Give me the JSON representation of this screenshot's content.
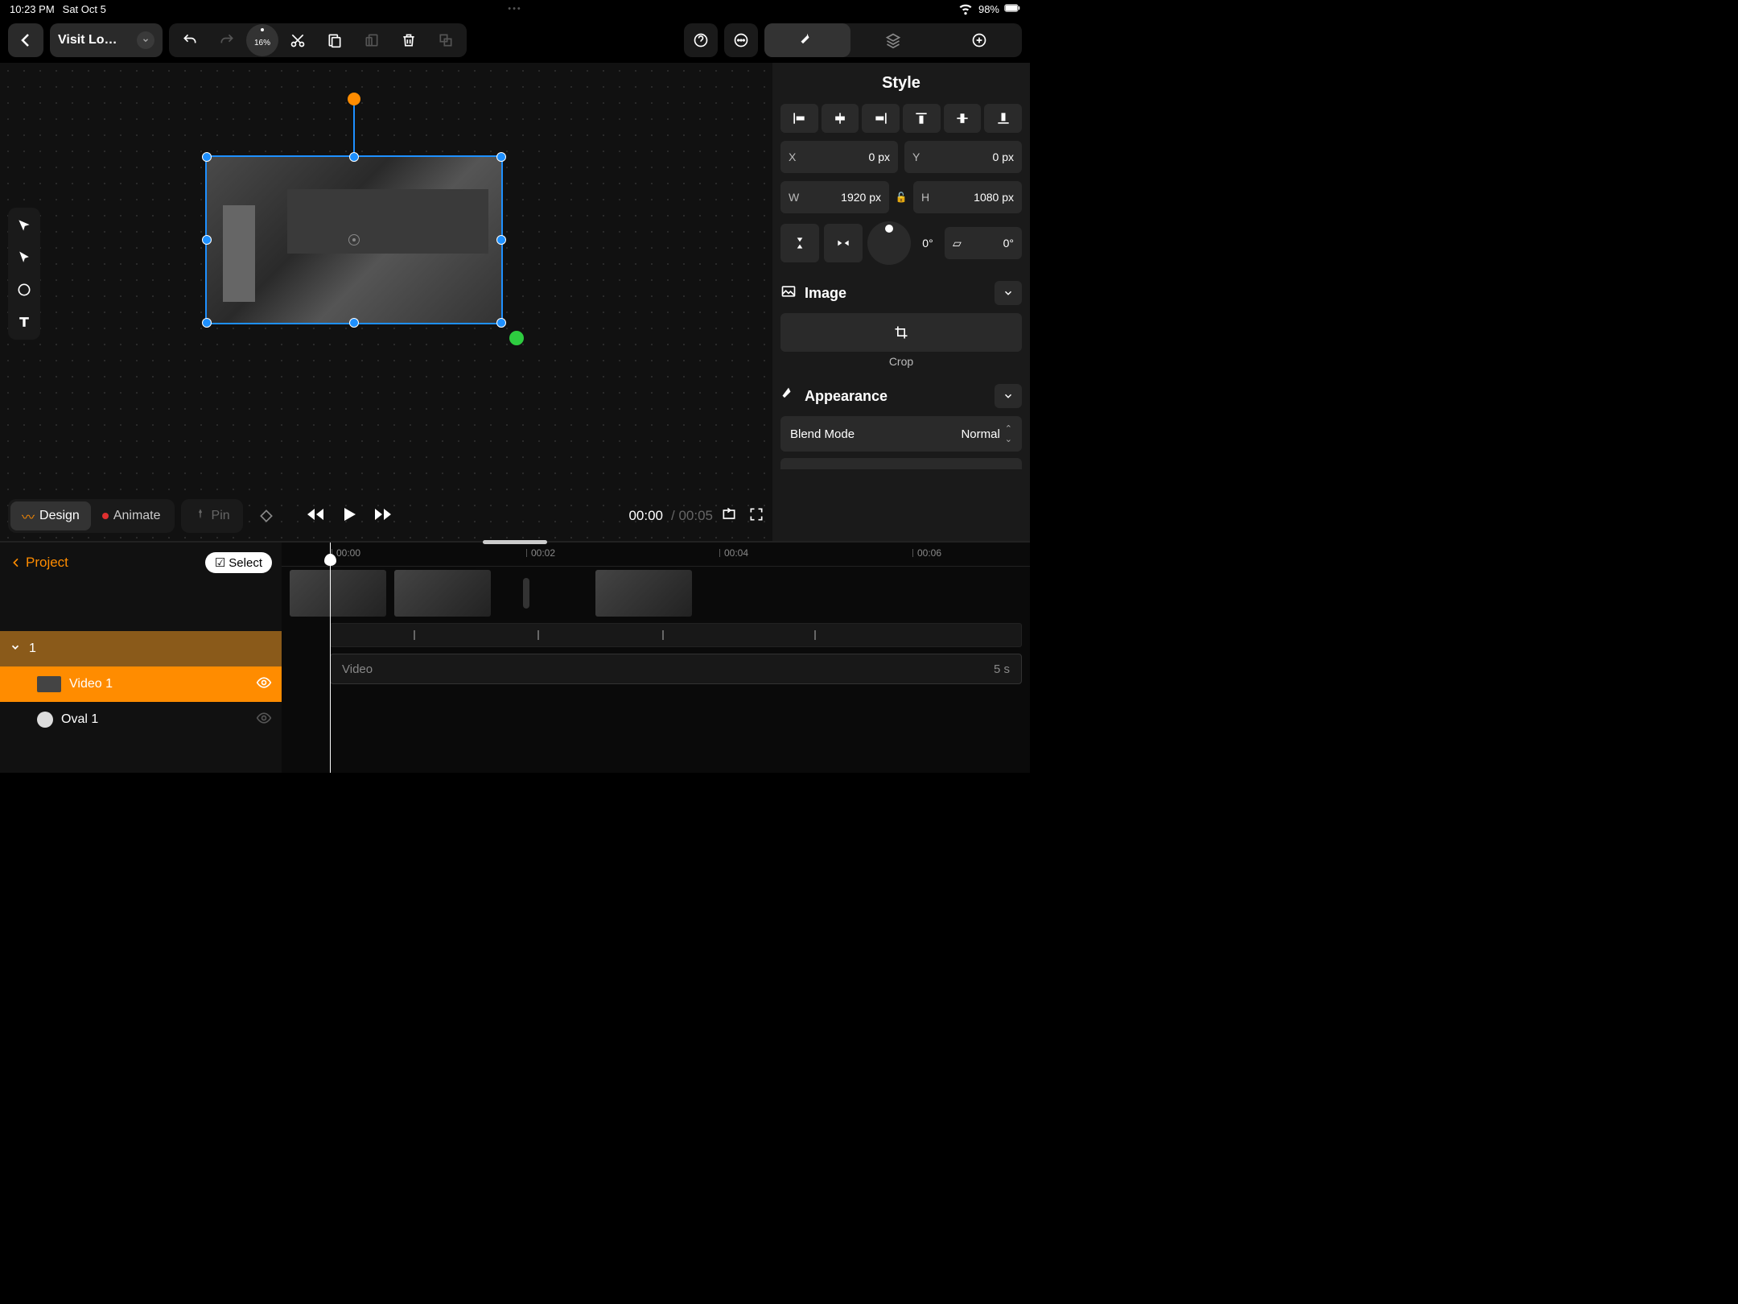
{
  "status": {
    "time": "10:23 PM",
    "date": "Sat Oct 5",
    "battery": "98%"
  },
  "project_name": "Visit Lo…",
  "zoom": "16%",
  "modes": {
    "design": "Design",
    "animate": "Animate",
    "pin": "Pin"
  },
  "time": {
    "current": "00:00",
    "duration": "00:05"
  },
  "style_panel": {
    "title": "Style",
    "x_label": "X",
    "x_value": "0 px",
    "y_label": "Y",
    "y_value": "0 px",
    "w_label": "W",
    "w_value": "1920 px",
    "h_label": "H",
    "h_value": "1080 px",
    "rotation": "0°",
    "skew": "0°",
    "image_section": "Image",
    "crop": "Crop",
    "appearance_section": "Appearance",
    "blend_mode_label": "Blend Mode",
    "blend_mode_value": "Normal"
  },
  "layers": {
    "back": "Project",
    "select": "Select",
    "group_name": "1",
    "items": [
      {
        "name": "Video 1",
        "selected": true
      },
      {
        "name": "Oval 1",
        "selected": false
      }
    ]
  },
  "timeline": {
    "ticks": [
      "00:00",
      "00:02",
      "00:04",
      "00:06"
    ],
    "video_label": "Video",
    "video_duration": "5 s"
  }
}
